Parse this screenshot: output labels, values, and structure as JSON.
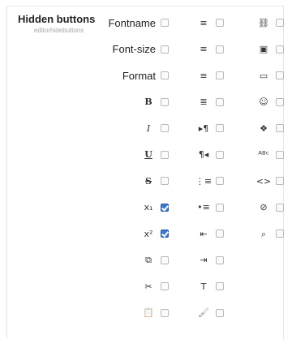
{
  "section": {
    "title": "Hidden buttons",
    "subtitle": "editorhidebuttons"
  },
  "columns": [
    {
      "items": [
        {
          "type": "text",
          "label": "Fontname",
          "icon": "",
          "checked": false
        },
        {
          "type": "text",
          "label": "Font-size",
          "icon": "",
          "checked": false
        },
        {
          "type": "text",
          "label": "Format",
          "icon": "",
          "checked": false
        },
        {
          "type": "icon",
          "icon": "bold-icon",
          "glyph": "B",
          "checked": false
        },
        {
          "type": "icon",
          "icon": "italic-icon",
          "glyph": "I",
          "checked": false
        },
        {
          "type": "icon",
          "icon": "underline-icon",
          "glyph": "U",
          "checked": false
        },
        {
          "type": "icon",
          "icon": "strikethrough-icon",
          "glyph": "S",
          "checked": false
        },
        {
          "type": "icon",
          "icon": "subscript-icon",
          "glyph": "x₁",
          "checked": true
        },
        {
          "type": "icon",
          "icon": "superscript-icon",
          "glyph": "x²",
          "checked": true
        },
        {
          "type": "icon",
          "icon": "copy-icon",
          "glyph": "⧉",
          "checked": false
        },
        {
          "type": "icon",
          "icon": "cut-icon",
          "glyph": "✂",
          "checked": false
        },
        {
          "type": "icon",
          "icon": "paste-icon",
          "glyph": "📋",
          "checked": false
        }
      ]
    },
    {
      "items": [
        {
          "type": "icon",
          "icon": "align-left-icon",
          "glyph": "≡",
          "checked": false
        },
        {
          "type": "icon",
          "icon": "align-center-icon",
          "glyph": "≡",
          "checked": false
        },
        {
          "type": "icon",
          "icon": "align-right-icon",
          "glyph": "≡",
          "checked": false
        },
        {
          "type": "icon",
          "icon": "justify-icon",
          "glyph": "≣",
          "checked": false
        },
        {
          "type": "icon",
          "icon": "ltr-icon",
          "glyph": "▸¶",
          "checked": false
        },
        {
          "type": "icon",
          "icon": "rtl-icon",
          "glyph": "¶◂",
          "checked": false
        },
        {
          "type": "icon",
          "icon": "ordered-list-icon",
          "glyph": "⋮≡",
          "checked": false
        },
        {
          "type": "icon",
          "icon": "unordered-list-icon",
          "glyph": "•≡",
          "checked": false
        },
        {
          "type": "icon",
          "icon": "outdent-icon",
          "glyph": "⇤",
          "checked": false
        },
        {
          "type": "icon",
          "icon": "indent-icon",
          "glyph": "⇥",
          "checked": false
        },
        {
          "type": "icon",
          "icon": "text-color-icon",
          "glyph": "T",
          "checked": false
        },
        {
          "type": "icon",
          "icon": "background-color-icon",
          "glyph": "🖌",
          "checked": false
        }
      ]
    },
    {
      "items": [
        {
          "type": "icon",
          "icon": "unlink-icon",
          "glyph": "⛓",
          "checked": false
        },
        {
          "type": "icon",
          "icon": "image-icon",
          "glyph": "▣",
          "checked": false
        },
        {
          "type": "icon",
          "icon": "table-icon",
          "glyph": "▭",
          "checked": false
        },
        {
          "type": "icon",
          "icon": "smiley-icon",
          "glyph": "☺",
          "checked": false
        },
        {
          "type": "icon",
          "icon": "special-char-icon",
          "glyph": "❖",
          "checked": false
        },
        {
          "type": "icon",
          "icon": "spellcheck-icon",
          "glyph": "ᴬᴮᶜ",
          "checked": false
        },
        {
          "type": "icon",
          "icon": "html-source-icon",
          "glyph": "<>",
          "checked": false
        },
        {
          "type": "icon",
          "icon": "clean-formatting-icon",
          "glyph": "⊘",
          "checked": false
        },
        {
          "type": "icon",
          "icon": "search-replace-icon",
          "glyph": "⌕",
          "checked": false
        }
      ]
    }
  ]
}
